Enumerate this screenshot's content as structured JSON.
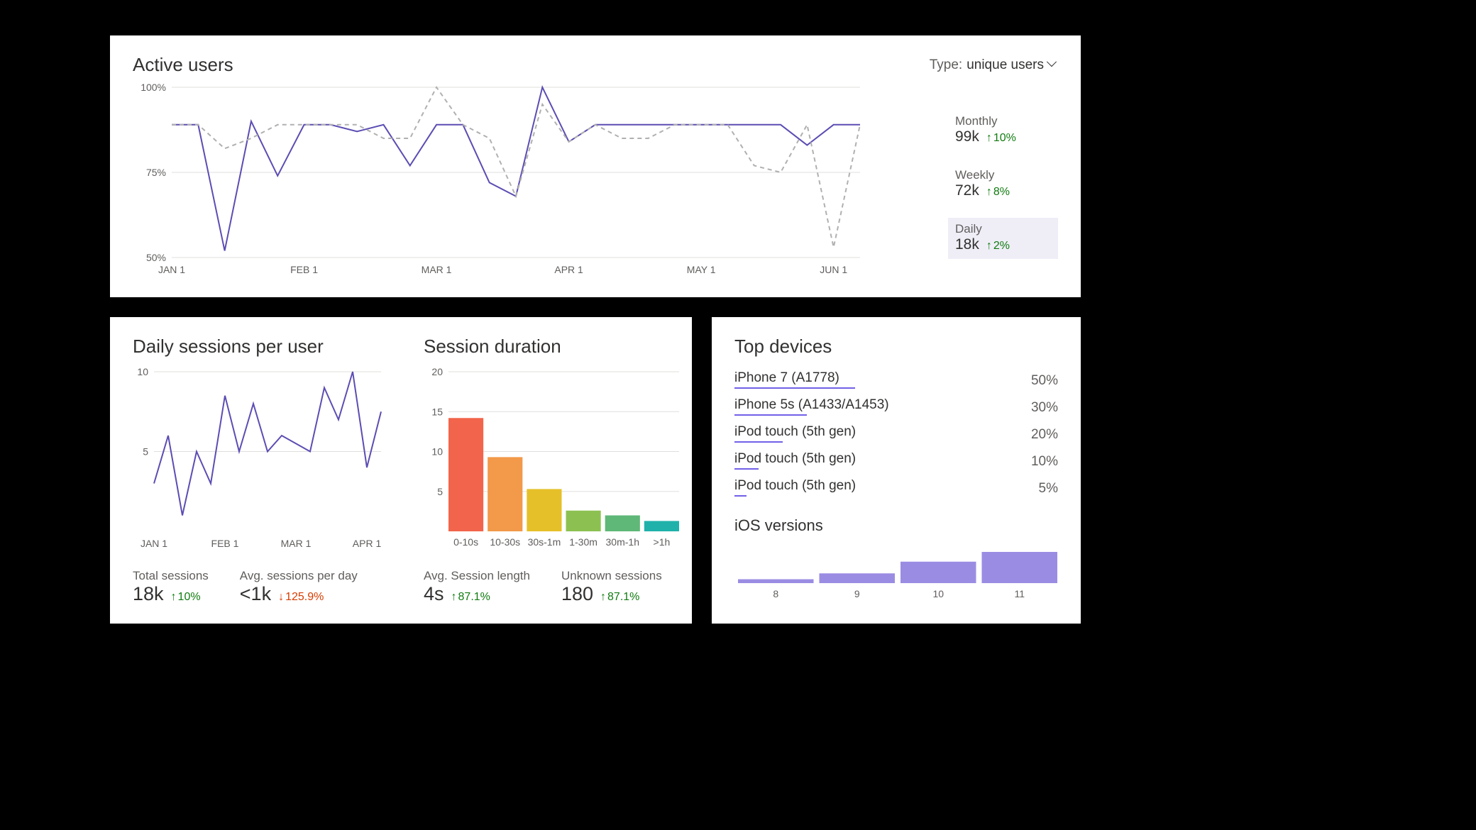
{
  "active_users": {
    "title": "Active users",
    "type_label": "Type:",
    "type_value": "unique users",
    "legend": [
      {
        "label": "Monthly",
        "value": "99k",
        "delta": "10%",
        "dir": "up"
      },
      {
        "label": "Weekly",
        "value": "72k",
        "delta": "8%",
        "dir": "up"
      },
      {
        "label": "Daily",
        "value": "18k",
        "delta": "2%",
        "dir": "up",
        "active": true
      }
    ]
  },
  "daily_sessions": {
    "title": "Daily sessions per user",
    "stats": [
      {
        "label": "Total sessions",
        "value": "18k",
        "delta": "10%",
        "dir": "up"
      },
      {
        "label": "Avg. sessions per day",
        "value": "<1k",
        "delta": "125.9%",
        "dir": "down"
      }
    ]
  },
  "session_duration": {
    "title": "Session duration",
    "stats": [
      {
        "label": "Avg. Session length",
        "value": "4s",
        "delta": "87.1%",
        "dir": "up"
      },
      {
        "label": "Unknown sessions",
        "value": "180",
        "delta": "87.1%",
        "dir": "up"
      }
    ]
  },
  "top_devices": {
    "title": "Top devices",
    "items": [
      {
        "name": "iPhone 7 (A1778)",
        "pct": "50%",
        "bar": 50
      },
      {
        "name": "iPhone 5s (A1433/A1453)",
        "pct": "30%",
        "bar": 30
      },
      {
        "name": "iPod touch (5th gen)",
        "pct": "20%",
        "bar": 20
      },
      {
        "name": "iPod touch (5th gen)",
        "pct": "10%",
        "bar": 10
      },
      {
        "name": "iPod touch (5th gen)",
        "pct": "5%",
        "bar": 5
      }
    ],
    "ios_title": "iOS versions"
  },
  "chart_data": [
    {
      "id": "active_users_chart",
      "type": "line",
      "title": "Active users",
      "ylabel": "%",
      "ylim": [
        50,
        100
      ],
      "yticks": [
        50,
        75,
        100
      ],
      "x_tick_labels": [
        "JAN 1",
        "FEB 1",
        "MAR 1",
        "APR 1",
        "MAY 1",
        "JUN 1"
      ],
      "x_tick_positions": [
        0,
        5,
        10,
        15,
        20,
        25
      ],
      "series": [
        {
          "name": "Selected (Daily, solid)",
          "style": "solid",
          "color": "#5b4db3",
          "values": [
            89,
            89,
            52,
            90,
            74,
            89,
            89,
            87,
            89,
            77,
            89,
            89,
            72,
            68,
            100,
            84,
            89,
            89,
            89,
            89,
            89,
            89,
            89,
            89,
            83,
            89,
            89
          ]
        },
        {
          "name": "Comparison (dashed)",
          "style": "dash",
          "color": "#b0b0b0",
          "values": [
            89,
            89,
            82,
            85,
            89,
            89,
            89,
            89,
            85,
            85,
            100,
            89,
            85,
            68,
            95,
            84,
            89,
            85,
            85,
            89,
            89,
            89,
            77,
            75,
            89,
            53,
            89
          ]
        }
      ]
    },
    {
      "id": "daily_sessions_chart",
      "type": "line",
      "title": "Daily sessions per user",
      "ylim": [
        0,
        10
      ],
      "yticks": [
        5,
        10
      ],
      "x_tick_labels": [
        "JAN 1",
        "FEB 1",
        "MAR 1",
        "APR 1"
      ],
      "x_tick_positions": [
        0,
        5,
        10,
        15
      ],
      "series": [
        {
          "name": "Sessions",
          "style": "solid",
          "color": "#5b4db3",
          "values": [
            3,
            6,
            1,
            5,
            3,
            8.5,
            5,
            8,
            5,
            6,
            5.5,
            5,
            9,
            7,
            10,
            4,
            7.5
          ]
        }
      ]
    },
    {
      "id": "session_duration_chart",
      "type": "bar",
      "title": "Session duration",
      "ylim": [
        0,
        20
      ],
      "yticks": [
        5,
        10,
        15,
        20
      ],
      "categories": [
        "0-10s",
        "10-30s",
        "30s-1m",
        "1-30m",
        "30m-1h",
        ">1h"
      ],
      "values": [
        14.2,
        9.3,
        5.3,
        2.6,
        2.0,
        1.3
      ],
      "colors": [
        "#f2644b",
        "#f2994a",
        "#e6c029",
        "#8cc152",
        "#5fb878",
        "#20b2aa"
      ]
    },
    {
      "id": "ios_versions_chart",
      "type": "bar",
      "title": "iOS versions",
      "ylim": [
        0,
        100
      ],
      "categories": [
        "8",
        "9",
        "10",
        "11"
      ],
      "values": [
        10,
        25,
        55,
        80
      ],
      "colors": [
        "#9b8ce3",
        "#9b8ce3",
        "#9b8ce3",
        "#9b8ce3"
      ]
    }
  ]
}
